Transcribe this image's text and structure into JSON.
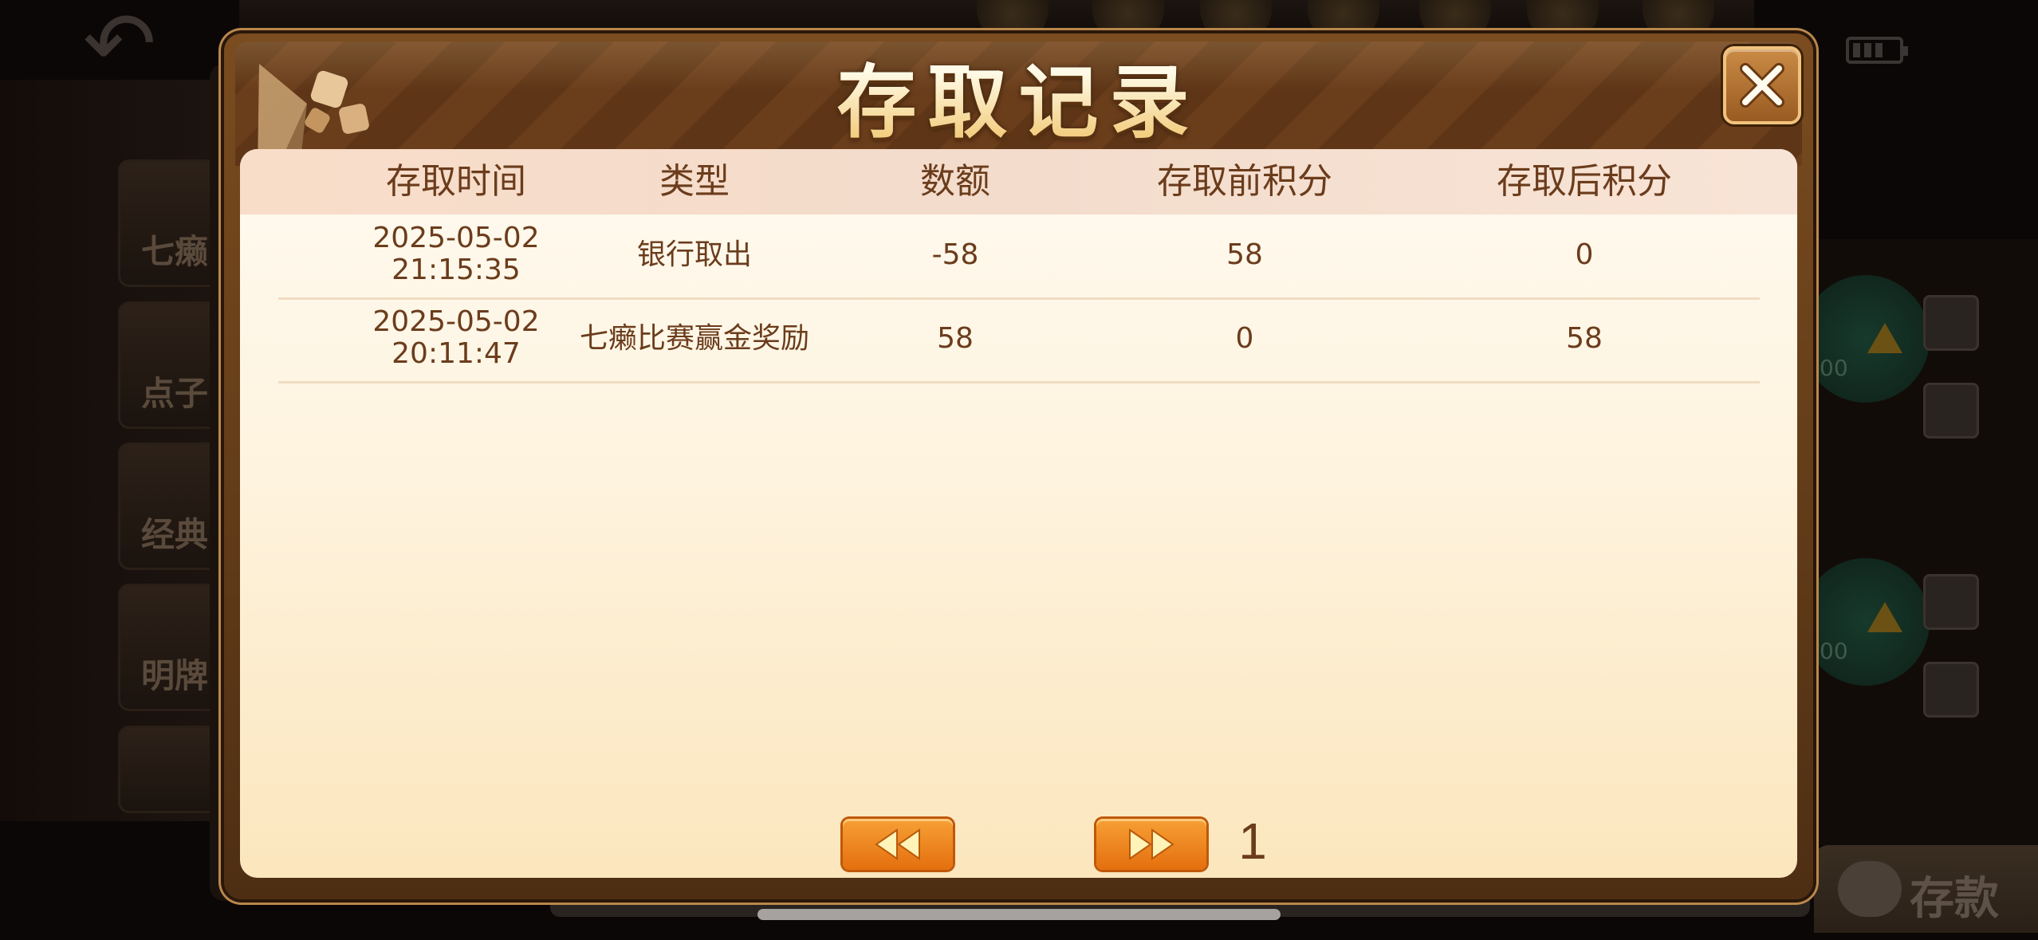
{
  "dialog": {
    "title": "存取记录"
  },
  "table": {
    "columns": [
      "存取时间",
      "类型",
      "数额",
      "存取前积分",
      "存取后积分"
    ],
    "rows": [
      {
        "date": "2025-05-02",
        "time": "21:15:35",
        "type": "银行取出",
        "amount": "-58",
        "before": "58",
        "after": "0"
      },
      {
        "date": "2025-05-02",
        "time": "20:11:47",
        "type": "七癞比赛赢金奖励",
        "amount": "58",
        "before": "0",
        "after": "58"
      }
    ]
  },
  "pagination": {
    "current_page": "1"
  },
  "background": {
    "sidebar_items": [
      "七癞",
      "点子",
      "经典",
      "明牌"
    ],
    "deposit_button": "存款",
    "table_score_1": "00",
    "table_score_2": "00"
  },
  "colors": {
    "accent_orange": "#e46f0e",
    "text_brown": "#6b3c1c",
    "panel_cream": "#fdf1d6"
  }
}
